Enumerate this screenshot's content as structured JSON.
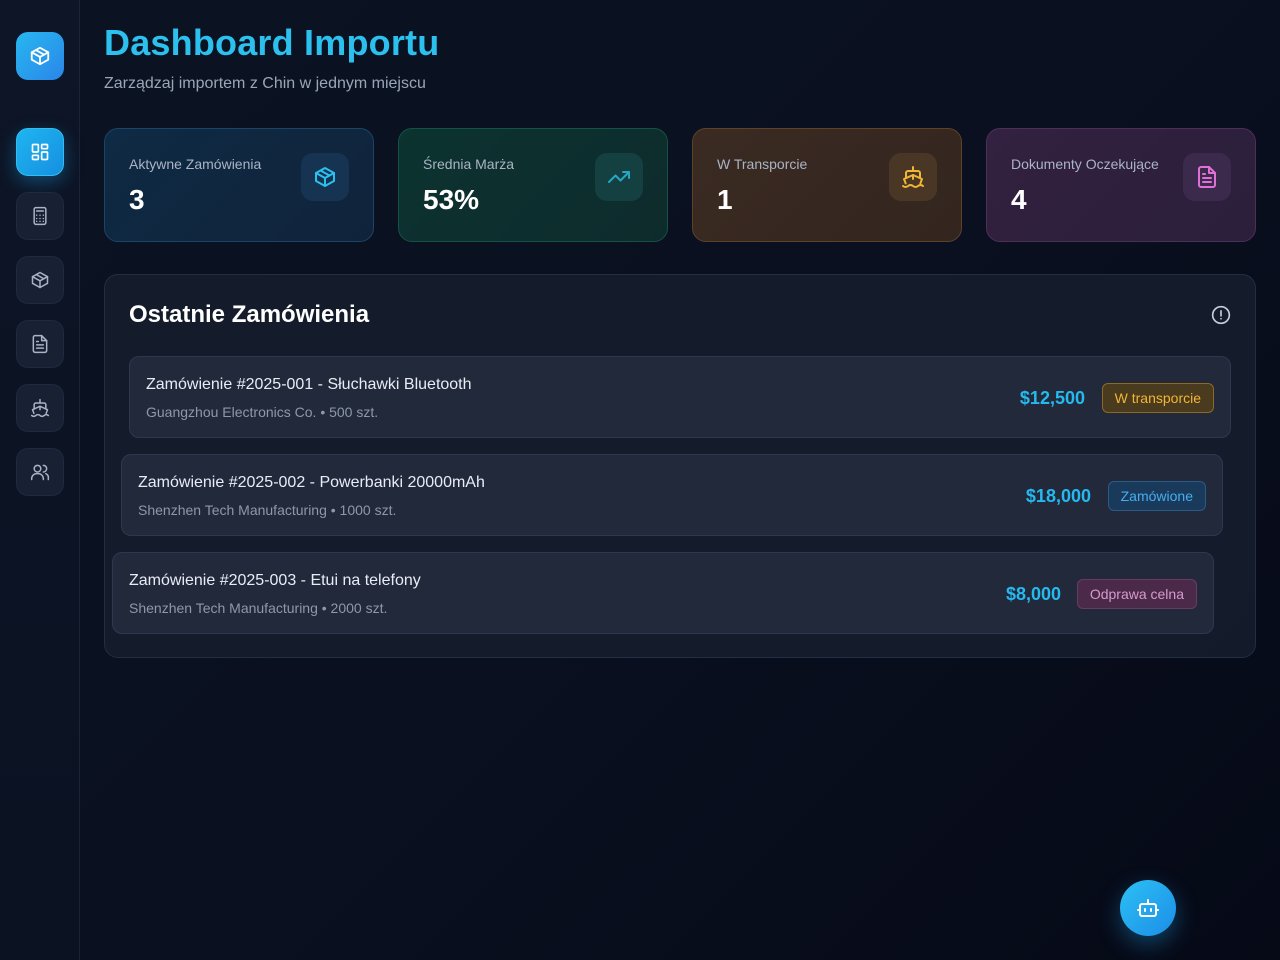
{
  "colors": {
    "accent": "#2cc0ee",
    "amount": "#25b9ee",
    "badge_transport": "#f0b636",
    "badge_ordered": "#45aef0",
    "badge_customs": "#d79ace"
  },
  "sidebar": {
    "logo_icon": "package-icon",
    "items": [
      {
        "icon": "dashboard-icon",
        "active": true
      },
      {
        "icon": "calculator-icon",
        "active": false
      },
      {
        "icon": "package-icon",
        "active": false
      },
      {
        "icon": "document-icon",
        "active": false
      },
      {
        "icon": "ship-icon",
        "active": false
      },
      {
        "icon": "users-icon",
        "active": false
      }
    ]
  },
  "header": {
    "title": "Dashboard Importu",
    "subtitle": "Zarządzaj importem z Chin w jednym miejscu"
  },
  "stats": [
    {
      "label": "Aktywne Zamówienia",
      "value": "3",
      "icon": "package-icon"
    },
    {
      "label": "Średnia Marża",
      "value": "53%",
      "icon": "trending-up-icon"
    },
    {
      "label": "W Transporcie",
      "value": "1",
      "icon": "ship-icon"
    },
    {
      "label": "Dokumenty Oczekujące",
      "value": "4",
      "icon": "document-icon"
    }
  ],
  "orders": {
    "title": "Ostatnie Zamówienia",
    "info_icon": "alert-circle-icon",
    "items": [
      {
        "title": "Zamówienie #2025-001 - Słuchawki Bluetooth",
        "subtitle": "Guangzhou Electronics Co. • 500 szt.",
        "amount": "$12,500",
        "status": "W transporcie"
      },
      {
        "title": "Zamówienie #2025-002 - Powerbanki 20000mAh",
        "subtitle": "Shenzhen Tech Manufacturing • 1000 szt.",
        "amount": "$18,000",
        "status": "Zamówione"
      },
      {
        "title": "Zamówienie #2025-003 - Etui na telefony",
        "subtitle": "Shenzhen Tech Manufacturing • 2000 szt.",
        "amount": "$8,000",
        "status": "Odprawa celna"
      }
    ]
  },
  "assistant": {
    "icon": "bot-icon"
  }
}
